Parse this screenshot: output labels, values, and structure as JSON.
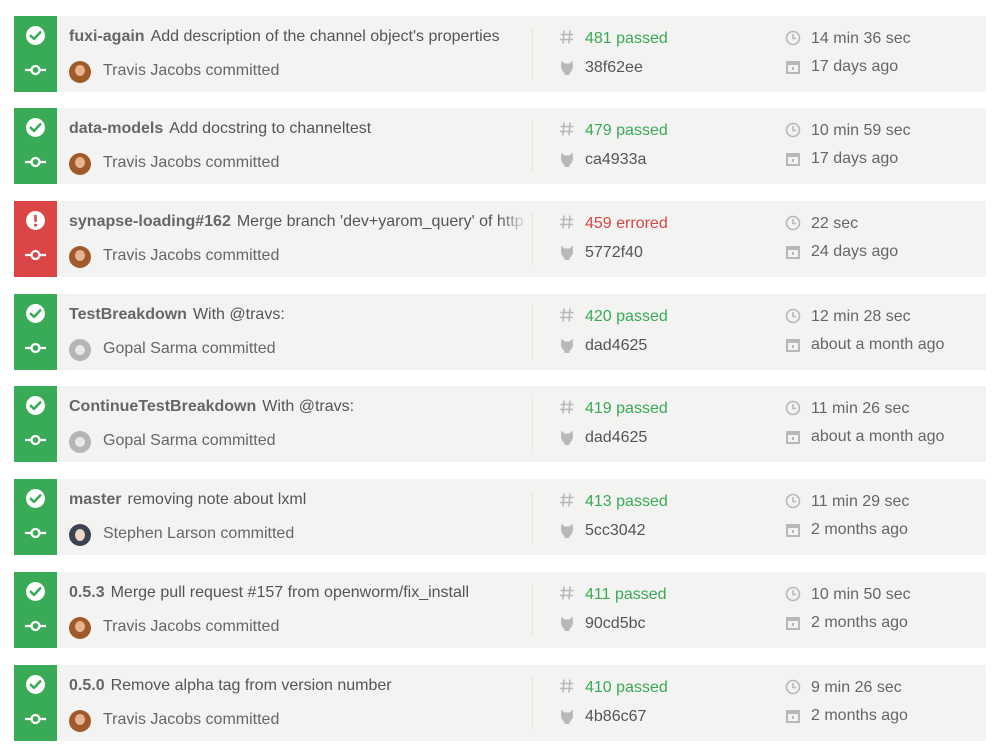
{
  "colors": {
    "passed": "#39aa56",
    "errored": "#db4545",
    "row_bg": "#f3f3f1"
  },
  "builds": [
    {
      "state": "passed",
      "branch": "fuxi-again",
      "message": "Add description of the channel object's properties",
      "author": "Travis Jacobs committed",
      "avatar": "brown",
      "number_text": "481 passed",
      "commit": "38f62ee",
      "duration": "14 min 36 sec",
      "finished": "17 days ago"
    },
    {
      "state": "passed",
      "branch": "data-models",
      "message": "Add docstring to channeltest",
      "author": "Travis Jacobs committed",
      "avatar": "brown",
      "number_text": "479 passed",
      "commit": "ca4933a",
      "duration": "10 min 59 sec",
      "finished": "17 days ago"
    },
    {
      "state": "errored",
      "branch": "synapse-loading#162",
      "message": "Merge branch 'dev+yarom_query' of http",
      "author": "Travis Jacobs committed",
      "avatar": "brown",
      "number_text": "459 errored",
      "commit": "5772f40",
      "duration": "22 sec",
      "finished": "24 days ago"
    },
    {
      "state": "passed",
      "branch": "TestBreakdown",
      "message": "With @travs:",
      "author": "Gopal Sarma committed",
      "avatar": "gray",
      "number_text": "420 passed",
      "commit": "dad4625",
      "duration": "12 min 28 sec",
      "finished": "about a month ago"
    },
    {
      "state": "passed",
      "branch": "ContinueTestBreakdown",
      "message": "With @travs:",
      "author": "Gopal Sarma committed",
      "avatar": "gray",
      "number_text": "419 passed",
      "commit": "dad4625",
      "duration": "11 min 26 sec",
      "finished": "about a month ago"
    },
    {
      "state": "passed",
      "branch": "master",
      "message": "removing note about lxml",
      "author": "Stephen Larson committed",
      "avatar": "dark",
      "number_text": "413 passed",
      "commit": "5cc3042",
      "duration": "11 min 29 sec",
      "finished": "2 months ago"
    },
    {
      "state": "passed",
      "branch": "0.5.3",
      "message": "Merge pull request #157 from openworm/fix_install",
      "author": "Travis Jacobs committed",
      "avatar": "brown",
      "number_text": "411 passed",
      "commit": "90cd5bc",
      "duration": "10 min 50 sec",
      "finished": "2 months ago"
    },
    {
      "state": "passed",
      "branch": "0.5.0",
      "message": "Remove alpha tag from version number",
      "author": "Travis Jacobs committed",
      "avatar": "brown",
      "number_text": "410 passed",
      "commit": "4b86c67",
      "duration": "9 min 26 sec",
      "finished": "2 months ago"
    }
  ]
}
